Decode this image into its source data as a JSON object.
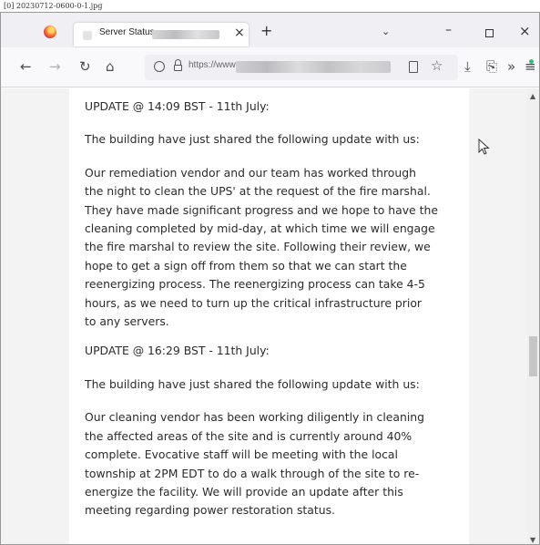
{
  "file_label": "[0] 20230712-0600-0-1.jpg",
  "browser": {
    "tab": {
      "title": "Server Status",
      "close": "×"
    },
    "new_tab": "+",
    "tab_list": "⌄",
    "window": {
      "minimize": "–",
      "close": "×"
    },
    "toolbar": {
      "back": "←",
      "forward": "→",
      "reload": "↻",
      "home": "⌂",
      "url": "https://www",
      "bookmark": "☆",
      "downloads": "⤓",
      "extensions_menu": "»",
      "share": "⎘",
      "more": "≡"
    }
  },
  "article": {
    "update1": {
      "heading": "UPDATE @ 14:09 BST - 11th July:",
      "intro": "The building have just shared the following update with us:",
      "lines": [
        "Our remediation vendor and our team has worked through",
        "the night to clean the UPS' at the request of the fire marshal.",
        "They have made significant progress and we hope to have the",
        "cleaning completed by mid-day, at which time we will engage",
        "the fire marshal to review the site.  Following their review, we",
        "hope to get a sign off from them so that we can start the",
        "reenergizing process. The reenergizing process can take 4-5",
        "hours, as we need to turn up the critical infrastructure prior",
        "to any servers."
      ]
    },
    "update2": {
      "heading": "UPDATE @ 16:29 BST - 11th July:",
      "intro": "The building have just shared the following update with us:",
      "lines": [
        "Our cleaning vendor has been working diligently in cleaning",
        "the affected areas of the site and is currently around 40%",
        "complete. Evocative staff will be meeting with the local",
        "township at 2PM EDT to do a walk through of the site to re-",
        "energize the facility. We will provide an update after this",
        "meeting regarding power restoration status."
      ]
    }
  },
  "scrollbar": {
    "up": "▲",
    "down": "▼",
    "position": 0.62
  }
}
